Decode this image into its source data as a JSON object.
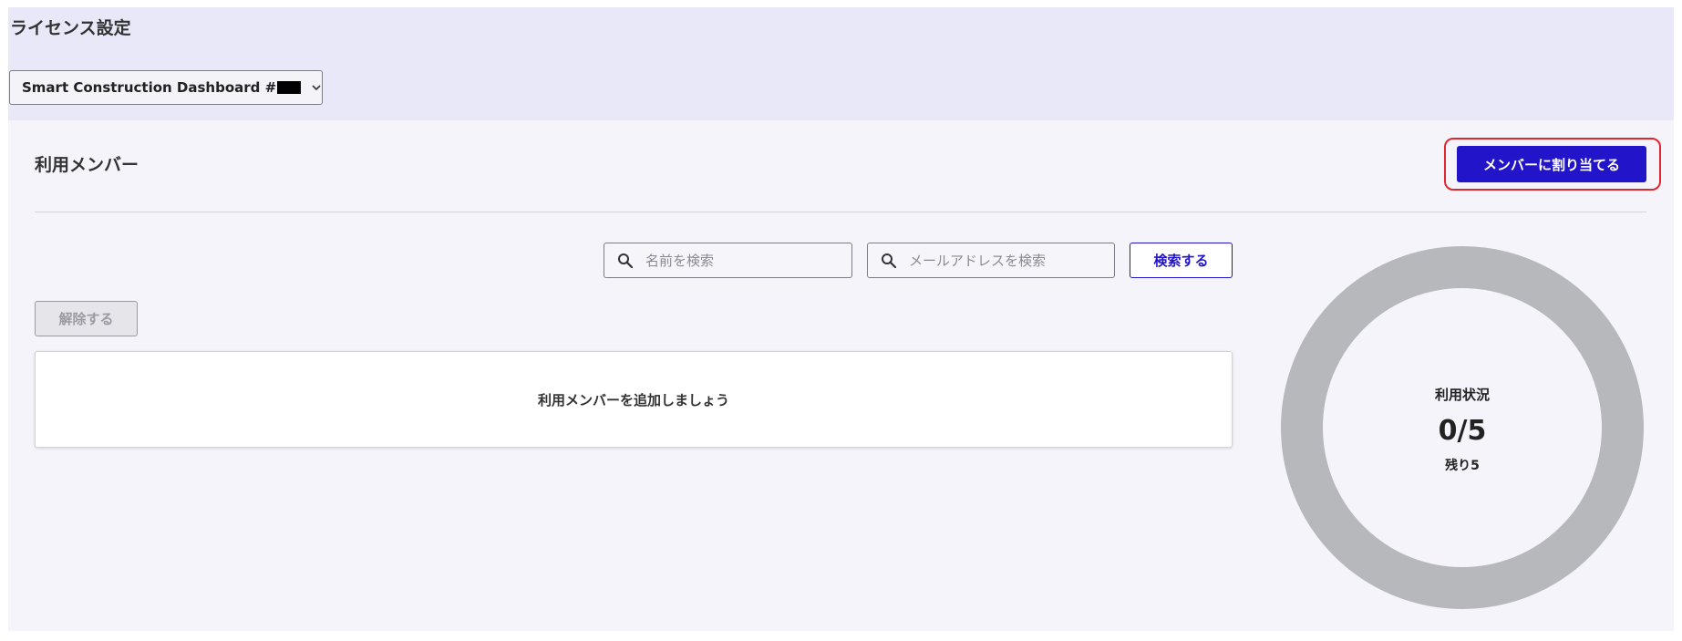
{
  "header": {
    "title": "ライセンス設定",
    "product_select": {
      "label": "Smart Construction Dashboard #",
      "icon": "chevron-down-icon"
    }
  },
  "members": {
    "section_title": "利用メンバー",
    "assign_button": "メンバーに割り当てる",
    "search": {
      "name_placeholder": "名前を検索",
      "email_placeholder": "メールアドレスを検索",
      "button": "検索する",
      "icon": "search-icon"
    },
    "remove_button": "解除する",
    "empty_message": "利用メンバーを追加しましょう"
  },
  "usage": {
    "title": "利用状況",
    "count": "0/5",
    "remaining": "残り5",
    "used": 0,
    "total": 5
  },
  "colors": {
    "primary": "#2214c8",
    "highlight": "#e0262e",
    "header_bg": "#e8e8f8",
    "panel_bg": "#f4f4fa",
    "ring": "#b6b8bc"
  }
}
